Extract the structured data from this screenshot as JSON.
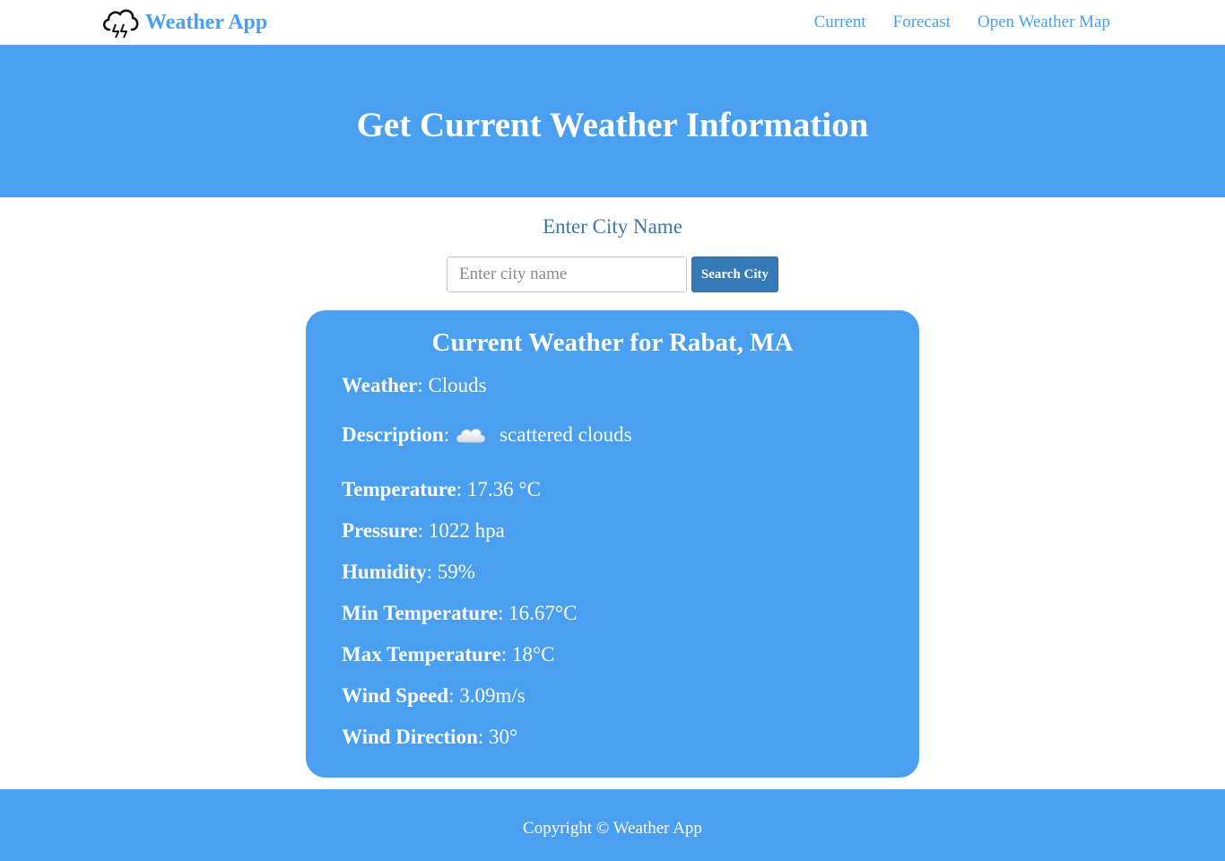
{
  "navbar": {
    "brand": "Weather App",
    "links": [
      "Current",
      "Forecast",
      "Open Weather Map"
    ]
  },
  "hero": {
    "title": "Get Current Weather Information"
  },
  "search": {
    "label": "Enter City Name",
    "placeholder": "Enter city name",
    "value": "",
    "button": "Search City"
  },
  "weather": {
    "title": "Current Weather for Rabat, MA",
    "fields": [
      {
        "label": "Weather",
        "value": "Clouds"
      },
      {
        "label": "Description",
        "value": "scattered clouds",
        "icon": "cloud-icon"
      },
      {
        "label": "Temperature",
        "value": "17.36 °C"
      },
      {
        "label": "Pressure",
        "value": "1022 hpa"
      },
      {
        "label": "Humidity",
        "value": "59%"
      },
      {
        "label": "Min Temperature",
        "value": "16.67°C"
      },
      {
        "label": "Max Temperature",
        "value": "18°C"
      },
      {
        "label": "Wind Speed",
        "value": "3.09m/s"
      },
      {
        "label": "Wind Direction",
        "value": "30°"
      }
    ]
  },
  "footer": {
    "copyright": "Copyright © Weather App"
  },
  "colors": {
    "primary": "#4a9ff0",
    "button": "#337ab7",
    "label": "#3a78a8"
  }
}
